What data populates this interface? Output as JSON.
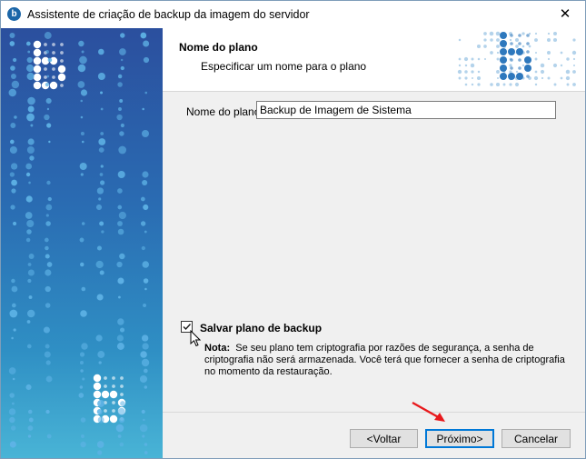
{
  "window": {
    "title": "Assistente de criação de backup da imagem do servidor",
    "close_symbol": "✕",
    "app_icon_letter": "b"
  },
  "header": {
    "title": "Nome do plano",
    "subtitle": "Especificar um nome para o plano"
  },
  "form": {
    "plan_label": "Nome do plano:",
    "plan_value": "Backup de Imagem de Sistema",
    "save_checkbox_label": "Salvar plano de backup",
    "save_checked": true,
    "note_prefix": "Nota:",
    "note_text": "Se seu plano tem criptografia por razões de segurança, a senha de criptografia não será armazenada. Você terá que fornecer a senha de criptografia no momento da restauração."
  },
  "buttons": {
    "back": "<Voltar",
    "next": "Próximo>",
    "cancel": "Cancelar"
  },
  "colors": {
    "brand_blue": "#1b66a8",
    "annotation_arrow": "#e8191c"
  },
  "icons": {
    "app": "app-logo-icon",
    "close": "close-icon",
    "checkbox": "checkmark-icon",
    "cursor": "mouse-cursor-icon",
    "annotation": "red-arrow-annotation"
  }
}
